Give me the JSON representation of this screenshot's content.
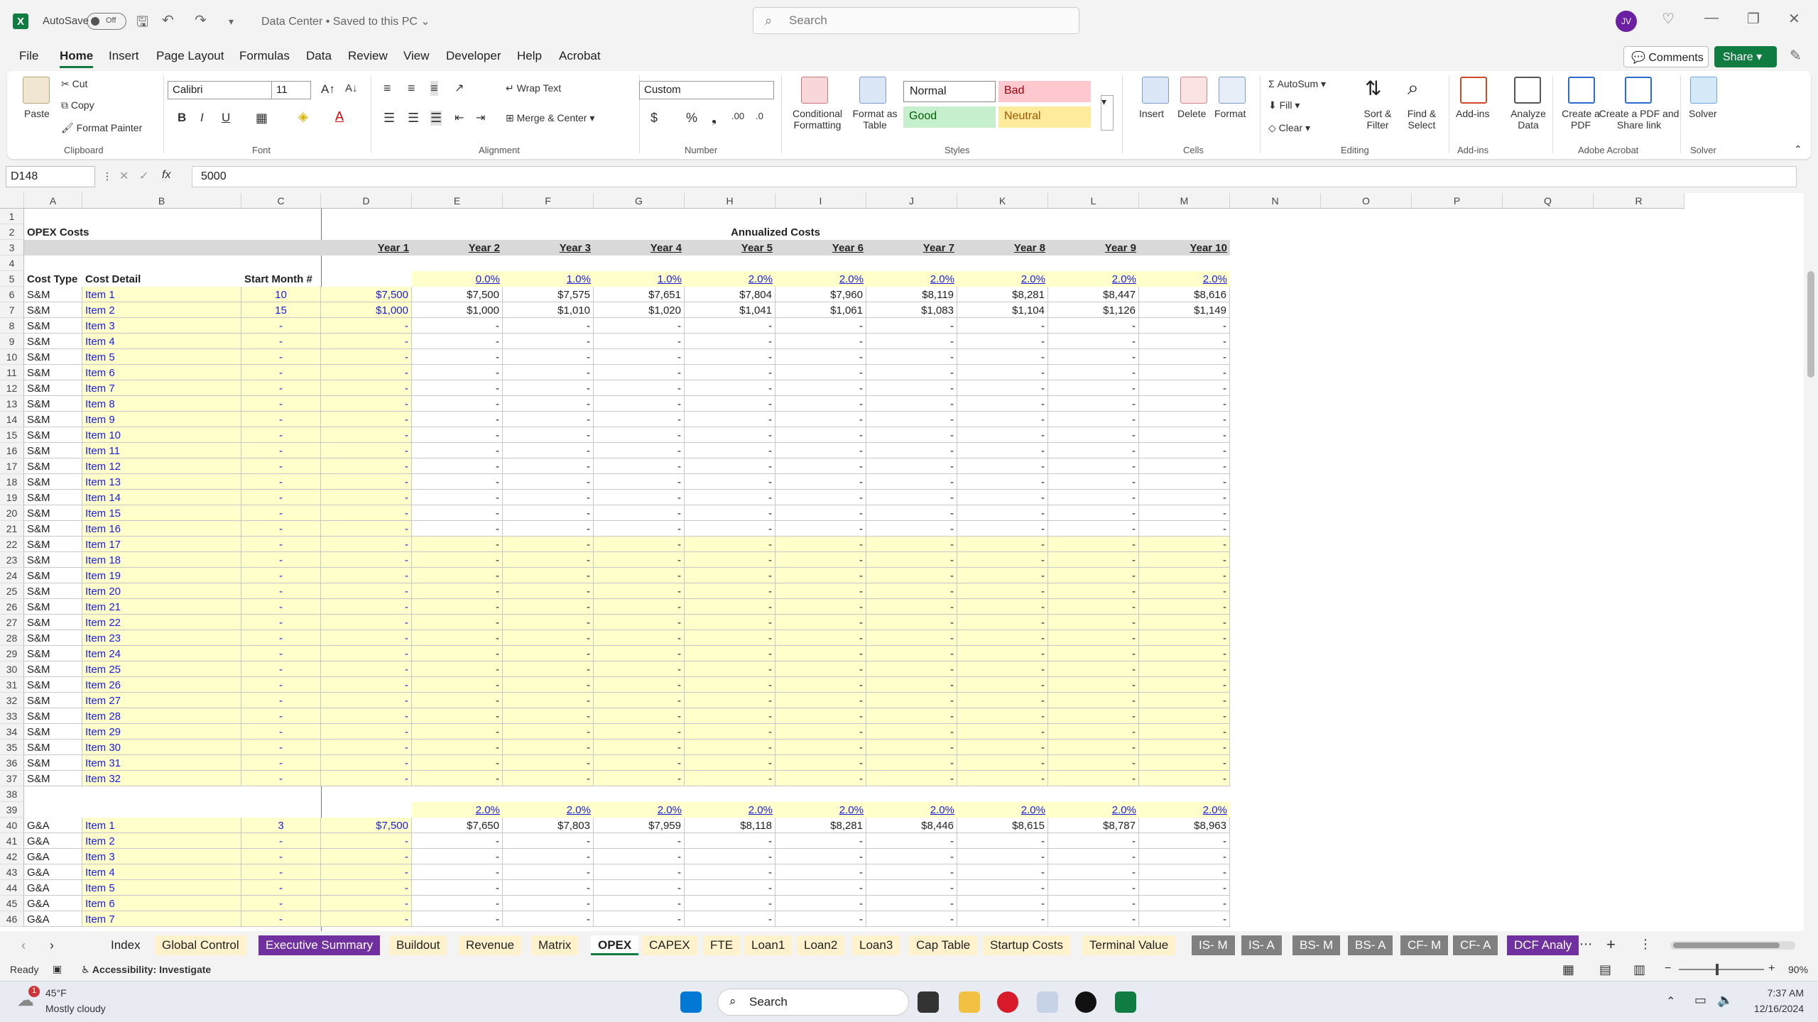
{
  "titlebar": {
    "autosave_label": "AutoSave",
    "autosave_state": "Off",
    "doc_title": "Data Center • Saved to this PC ⌄",
    "search_placeholder": "Search",
    "avatar_initials": "JV"
  },
  "menu": [
    "File",
    "Home",
    "Insert",
    "Page Layout",
    "Formulas",
    "Data",
    "Review",
    "View",
    "Developer",
    "Help",
    "Acrobat"
  ],
  "menu_active": "Home",
  "top_right": {
    "comments": "Comments",
    "share": "Share"
  },
  "ribbon": {
    "clipboard": {
      "paste": "Paste",
      "cut": "Cut",
      "copy": "Copy",
      "format_painter": "Format Painter",
      "group": "Clipboard"
    },
    "font": {
      "name": "Calibri",
      "size": "11",
      "group": "Font",
      "bold": "B",
      "italic": "I",
      "underline": "U"
    },
    "alignment": {
      "wrap": "Wrap Text",
      "merge": "Merge & Center",
      "group": "Alignment"
    },
    "number": {
      "format": "Custom",
      "group": "Number"
    },
    "styles": {
      "cond": "Conditional Formatting",
      "table": "Format as Table",
      "normal": "Normal",
      "bad": "Bad",
      "good": "Good",
      "neutral": "Neutral",
      "group": "Styles"
    },
    "cells": {
      "insert": "Insert",
      "delete": "Delete",
      "format": "Format",
      "group": "Cells"
    },
    "editing": {
      "autosum": "AutoSum",
      "fill": "Fill",
      "clear": "Clear",
      "sort": "Sort & Filter",
      "find": "Find & Select",
      "group": "Editing"
    },
    "addins": {
      "addins": "Add-ins",
      "analyze": "Analyze Data",
      "group": "Add-ins"
    },
    "acrobat": {
      "create_pdf": "Create a PDF",
      "create_share": "Create a PDF and Share link",
      "group": "Adobe Acrobat"
    },
    "solver": {
      "solver": "Solver",
      "group": "Solver"
    }
  },
  "formula_bar": {
    "name_box": "D148",
    "fx": "fx",
    "value": "5000"
  },
  "columns": [
    "A",
    "B",
    "C",
    "D",
    "E",
    "F",
    "G",
    "H",
    "I",
    "J",
    "K",
    "L",
    "M",
    "N",
    "O",
    "P",
    "Q",
    "R"
  ],
  "sheet": {
    "title": "OPEX Costs",
    "annualized": "Annualized Costs",
    "years": [
      "Year 1",
      "Year 2",
      "Year 3",
      "Year 4",
      "Year 5",
      "Year 6",
      "Year 7",
      "Year 8",
      "Year 9",
      "Year 10"
    ],
    "hdr_cost_type": "Cost Type",
    "hdr_cost_detail": "Cost Detail",
    "hdr_start_month": "Start Month #",
    "growth_sm": [
      "0.0%",
      "1.0%",
      "1.0%",
      "2.0%",
      "2.0%",
      "2.0%",
      "2.0%",
      "2.0%",
      "2.0%"
    ],
    "growth_ga": [
      "2.0%",
      "2.0%",
      "2.0%",
      "2.0%",
      "2.0%",
      "2.0%",
      "2.0%",
      "2.0%",
      "2.0%"
    ],
    "sm_rows": [
      {
        "type": "S&M",
        "item": "Item 1",
        "start": "10",
        "vals": [
          "$7,500",
          "$7,500",
          "$7,575",
          "$7,651",
          "$7,804",
          "$7,960",
          "$8,119",
          "$8,281",
          "$8,447",
          "$8,616"
        ]
      },
      {
        "type": "S&M",
        "item": "Item 2",
        "start": "15",
        "vals": [
          "$1,000",
          "$1,000",
          "$1,010",
          "$1,020",
          "$1,041",
          "$1,061",
          "$1,083",
          "$1,104",
          "$1,126",
          "$1,149"
        ]
      },
      {
        "type": "S&M",
        "item": "Item 3",
        "start": "-"
      },
      {
        "type": "S&M",
        "item": "Item 4",
        "start": "-"
      },
      {
        "type": "S&M",
        "item": "Item 5",
        "start": "-"
      },
      {
        "type": "S&M",
        "item": "Item 6",
        "start": "-"
      },
      {
        "type": "S&M",
        "item": "Item 7",
        "start": "-"
      },
      {
        "type": "S&M",
        "item": "Item 8",
        "start": "-"
      },
      {
        "type": "S&M",
        "item": "Item 9",
        "start": "-"
      },
      {
        "type": "S&M",
        "item": "Item 10",
        "start": "-"
      },
      {
        "type": "S&M",
        "item": "Item 11",
        "start": "-"
      },
      {
        "type": "S&M",
        "item": "Item 12",
        "start": "-"
      },
      {
        "type": "S&M",
        "item": "Item 13",
        "start": "-"
      },
      {
        "type": "S&M",
        "item": "Item 14",
        "start": "-"
      },
      {
        "type": "S&M",
        "item": "Item 15",
        "start": "-"
      },
      {
        "type": "S&M",
        "item": "Item 16",
        "start": "-"
      },
      {
        "type": "S&M",
        "item": "Item 17",
        "start": "-"
      },
      {
        "type": "S&M",
        "item": "Item 18",
        "start": "-"
      },
      {
        "type": "S&M",
        "item": "Item 19",
        "start": "-"
      },
      {
        "type": "S&M",
        "item": "Item 20",
        "start": "-"
      },
      {
        "type": "S&M",
        "item": "Item 21",
        "start": "-"
      },
      {
        "type": "S&M",
        "item": "Item 22",
        "start": "-"
      },
      {
        "type": "S&M",
        "item": "Item 23",
        "start": "-"
      },
      {
        "type": "S&M",
        "item": "Item 24",
        "start": "-"
      },
      {
        "type": "S&M",
        "item": "Item 25",
        "start": "-"
      },
      {
        "type": "S&M",
        "item": "Item 26",
        "start": "-"
      },
      {
        "type": "S&M",
        "item": "Item 27",
        "start": "-"
      },
      {
        "type": "S&M",
        "item": "Item 28",
        "start": "-"
      },
      {
        "type": "S&M",
        "item": "Item 29",
        "start": "-"
      },
      {
        "type": "S&M",
        "item": "Item 30",
        "start": "-"
      },
      {
        "type": "S&M",
        "item": "Item 31",
        "start": "-"
      },
      {
        "type": "S&M",
        "item": "Item 32",
        "start": "-"
      }
    ],
    "ga_rows": [
      {
        "type": "G&A",
        "item": "Item 1",
        "start": "3",
        "vals": [
          "$7,500",
          "$7,650",
          "$7,803",
          "$7,959",
          "$8,118",
          "$8,281",
          "$8,446",
          "$8,615",
          "$8,787",
          "$8,963"
        ]
      },
      {
        "type": "G&A",
        "item": "Item 2",
        "start": "-"
      },
      {
        "type": "G&A",
        "item": "Item 3",
        "start": "-"
      },
      {
        "type": "G&A",
        "item": "Item 4",
        "start": "-"
      },
      {
        "type": "G&A",
        "item": "Item 5",
        "start": "-"
      },
      {
        "type": "G&A",
        "item": "Item 6",
        "start": "-"
      },
      {
        "type": "G&A",
        "item": "Item 7",
        "start": "-"
      }
    ],
    "dash": "-"
  },
  "tabs": [
    "Index",
    "Global Control",
    "Executive Summary",
    "Buildout",
    "Revenue",
    "Matrix",
    "OPEX",
    "CAPEX",
    "FTE",
    "Loan1",
    "Loan2",
    "Loan3",
    "Cap Table",
    "Startup Costs",
    "Terminal Value",
    "IS- M",
    "IS- A",
    "BS- M",
    "BS- A",
    "CF- M",
    "CF- A",
    "DCF Analy"
  ],
  "tab_active": "OPEX",
  "status": {
    "ready": "Ready",
    "accessibility": "Accessibility: Investigate",
    "zoom": "90%"
  },
  "taskbar": {
    "weather_temp": "45°F",
    "weather_desc": "Mostly cloudy",
    "search": "Search",
    "time": "7:37 AM",
    "date": "12/16/2024",
    "badge": "1"
  }
}
